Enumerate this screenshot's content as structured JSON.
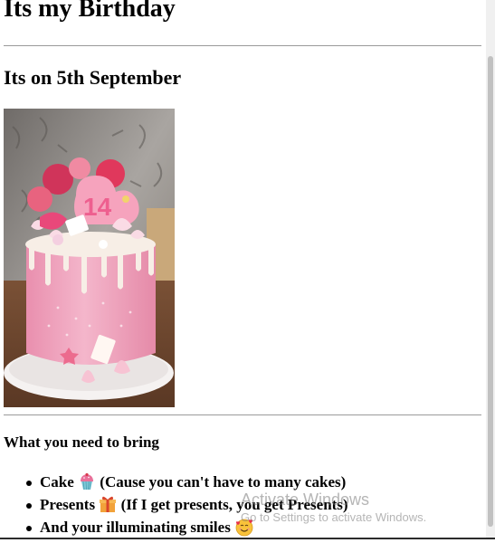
{
  "page": {
    "title": "Its my Birthday",
    "subtitle": "Its on 5th September"
  },
  "photo": {
    "subject": "pink-birthday-cake-image",
    "cake_topper": "14"
  },
  "bring": {
    "title": "What you need to bring",
    "items": [
      {
        "text": "Cake",
        "icon": "cupcake-icon",
        "suffix": "(Cause you can't have to many cakes)"
      },
      {
        "text": "Presents",
        "icon": "gift-icon",
        "suffix": "(If I get presents, you get Presents)"
      },
      {
        "text": "And your illuminating smiles",
        "icon": "smiling-face-hearts-icon",
        "suffix": ""
      }
    ]
  },
  "watermark": {
    "title": "Activate Windows",
    "subtitle": "Go to Settings to activate Windows."
  },
  "colors": {
    "accent_pink": "#f3a6bf",
    "gift_orange": "#f2a23a",
    "emoji_yellow": "#f8c23a"
  }
}
